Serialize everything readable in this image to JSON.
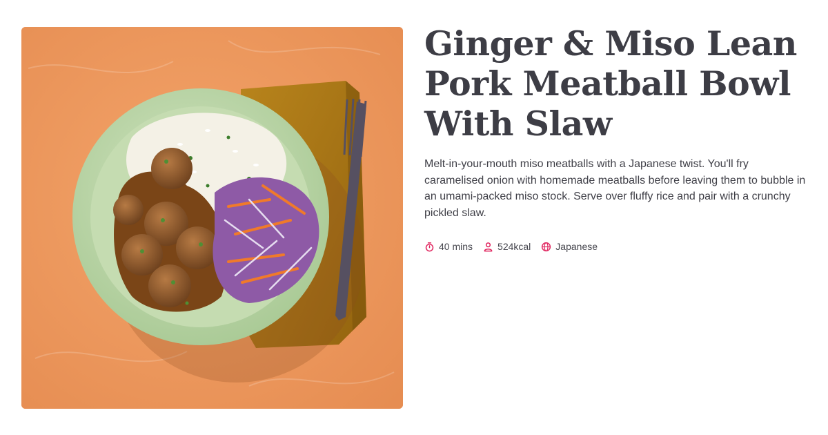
{
  "recipe": {
    "title": "Ginger & Miso Lean Pork Meatball Bowl With Slaw",
    "description": "Melt-in-your-mouth miso meatballs with a Japanese twist. You'll fry caramelised onion with homemade meatballs before leaving them to bubble in an umami-packed miso stock. Serve over fluffy rice and pair with a crunchy pickled slaw.",
    "meta": [
      {
        "icon": "timer-icon",
        "label": "40 mins"
      },
      {
        "icon": "person-icon",
        "label": "524kcal"
      },
      {
        "icon": "globe-icon",
        "label": "Japanese"
      }
    ]
  },
  "colors": {
    "icon_accent": "#e0245e",
    "background_orange": "#ee9a5e",
    "plate_green": "#b9d6a6"
  }
}
